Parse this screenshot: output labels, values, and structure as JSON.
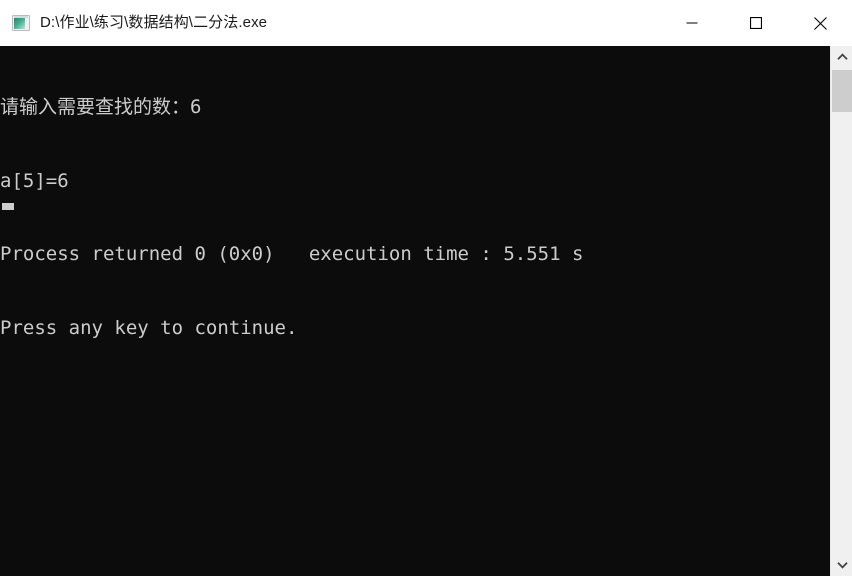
{
  "window": {
    "title": "D:\\作业\\练习\\数据结构\\二分法.exe",
    "icon": "console-window-icon",
    "background_color": "#0c0c0c",
    "titlebar_color": "#ffffff",
    "text_color": "#cccccc"
  },
  "controls": {
    "minimize": {
      "name": "minimize-button",
      "glyph": "—"
    },
    "maximize": {
      "name": "maximize-button",
      "glyph": "☐"
    },
    "close": {
      "name": "close-button",
      "glyph": "✕"
    }
  },
  "console": {
    "lines": [
      "请输入需要查找的数：6",
      "a[5]=6",
      "Process returned 0 (0x0)   execution time : 5.551 s",
      "Press any key to continue."
    ],
    "cursor_visible": true,
    "cursor_line": 5,
    "cursor_column": 1
  },
  "scrollbar": {
    "name": "vertical-scrollbar",
    "up_arrow": "chevron-up-icon",
    "down_arrow": "chevron-down-icon",
    "thumb_position": "top",
    "track_color": "#f0f0f0",
    "thumb_color": "#cdcdcd"
  }
}
